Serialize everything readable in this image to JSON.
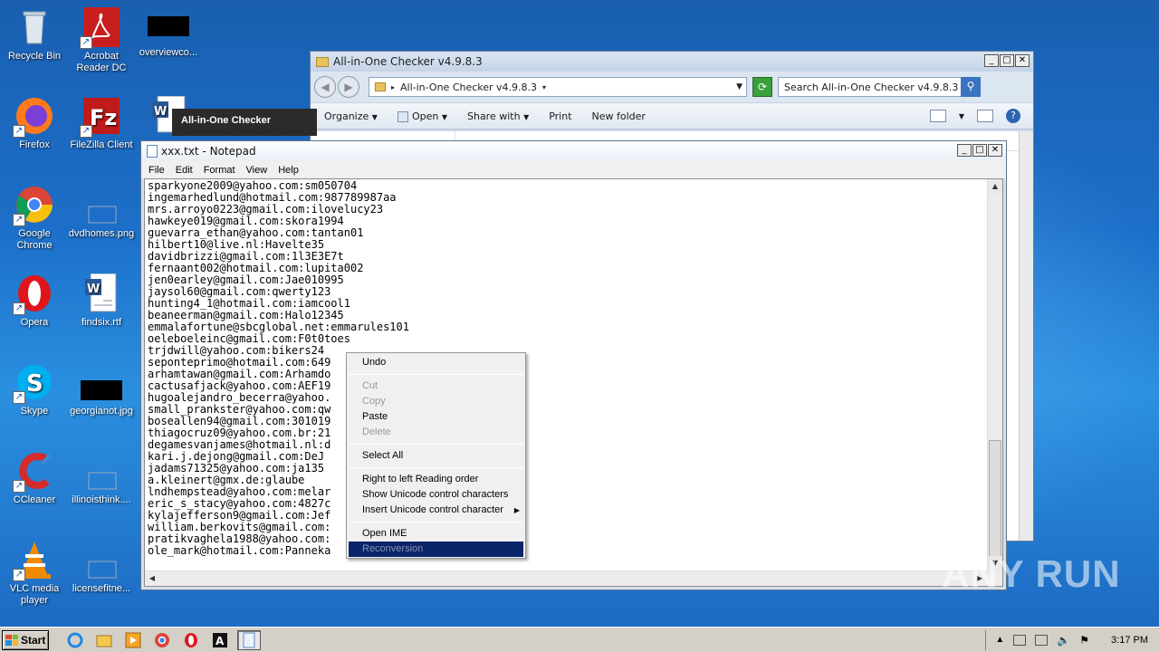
{
  "desktop": {
    "icons": [
      {
        "label": "Recycle Bin"
      },
      {
        "label": "Acrobat Reader DC"
      },
      {
        "label": "overviewco..."
      },
      {
        "label": "Firefox"
      },
      {
        "label": "FileZilla Client"
      },
      {
        "label": "Google Chrome"
      },
      {
        "label": "dvdhomes.png"
      },
      {
        "label": "Opera"
      },
      {
        "label": "findsix.rtf"
      },
      {
        "label": "Skype"
      },
      {
        "label": "georgianot.jpg"
      },
      {
        "label": "CCleaner"
      },
      {
        "label": "illinoisthink...."
      },
      {
        "label": "VLC media player"
      },
      {
        "label": "licensefitne..."
      }
    ]
  },
  "checker_window": {
    "title": "All-in-One Checker"
  },
  "explorer": {
    "title": "All-in-One Checker v4.9.8.3",
    "address": "All-in-One Checker v4.9.8.3",
    "search_placeholder": "Search All-in-One Checker v4.9.8.3",
    "toolbar": {
      "organize": "Organize",
      "open": "Open",
      "share_with": "Share with",
      "print": "Print",
      "new_folder": "New folder"
    }
  },
  "notepad": {
    "title": "xxx.txt - Notepad",
    "menu": [
      "File",
      "Edit",
      "Format",
      "View",
      "Help"
    ],
    "lines": [
      "sparkyone2009@yahoo.com:sm050704",
      "ingemarhedlund@hotmail.com:987789987aa",
      "mrs.arroyo0223@gmail.com:ilovelucy23",
      "hawkeye019@gmail.com:skora1994",
      "guevarra_ethan@yahoo.com:tantan01",
      "hilbert10@live.nl:Havelte35",
      "davidbrizzi@gmail.com:1l3E3E7t",
      "fernaant002@hotmail.com:lupita002",
      "jen0earley@gmail.com:Jae010995",
      "jaysol60@gmail.com:qwerty123",
      "hunting4_1@hotmail.com:iamcool1",
      "beaneerman@gmail.com:Halo12345",
      "emmalafortune@sbcglobal.net:emmarules101",
      "oeleboeleinc@gmail.com:F0t0toes",
      "trjdwill@yahoo.com:bikers24",
      "seponteprimo@hotmail.com:649",
      "arhamtawan@gmail.com:Arhamdo",
      "cactusafjack@yahoo.com:AEF19",
      "hugoalejandro_becerra@yahoo.",
      "small_prankster@yahoo.com:qw",
      "boseallen94@gmail.com:301019",
      "thiagocruz09@yahoo.com.br:21",
      "degamesvanjames@hotmail.nl:d",
      "kari.j.dejong@gmail.com:DeJ",
      "jadams71325@yahoo.com:ja135",
      "a.kleinert@gmx.de:glaube",
      "lndhempstead@yahoo.com:melar",
      "eric_s_stacy@yahoo.com:4827c",
      "kylajefferson9@gmail.com:Jef",
      "william.berkovits@gmail.com:",
      "pratikvaghela1988@yahoo.com:",
      "ole_mark@hotmail.com:Panneka"
    ]
  },
  "context_menu": {
    "undo": "Undo",
    "cut": "Cut",
    "copy": "Copy",
    "paste": "Paste",
    "delete": "Delete",
    "select_all": "Select All",
    "rtl": "Right to left Reading order",
    "show_unicode": "Show Unicode control characters",
    "insert_unicode": "Insert Unicode control character",
    "open_ime": "Open IME",
    "reconversion": "Reconversion"
  },
  "taskbar": {
    "start": "Start",
    "clock": "3:17 PM"
  },
  "watermark": "ANY RUN"
}
